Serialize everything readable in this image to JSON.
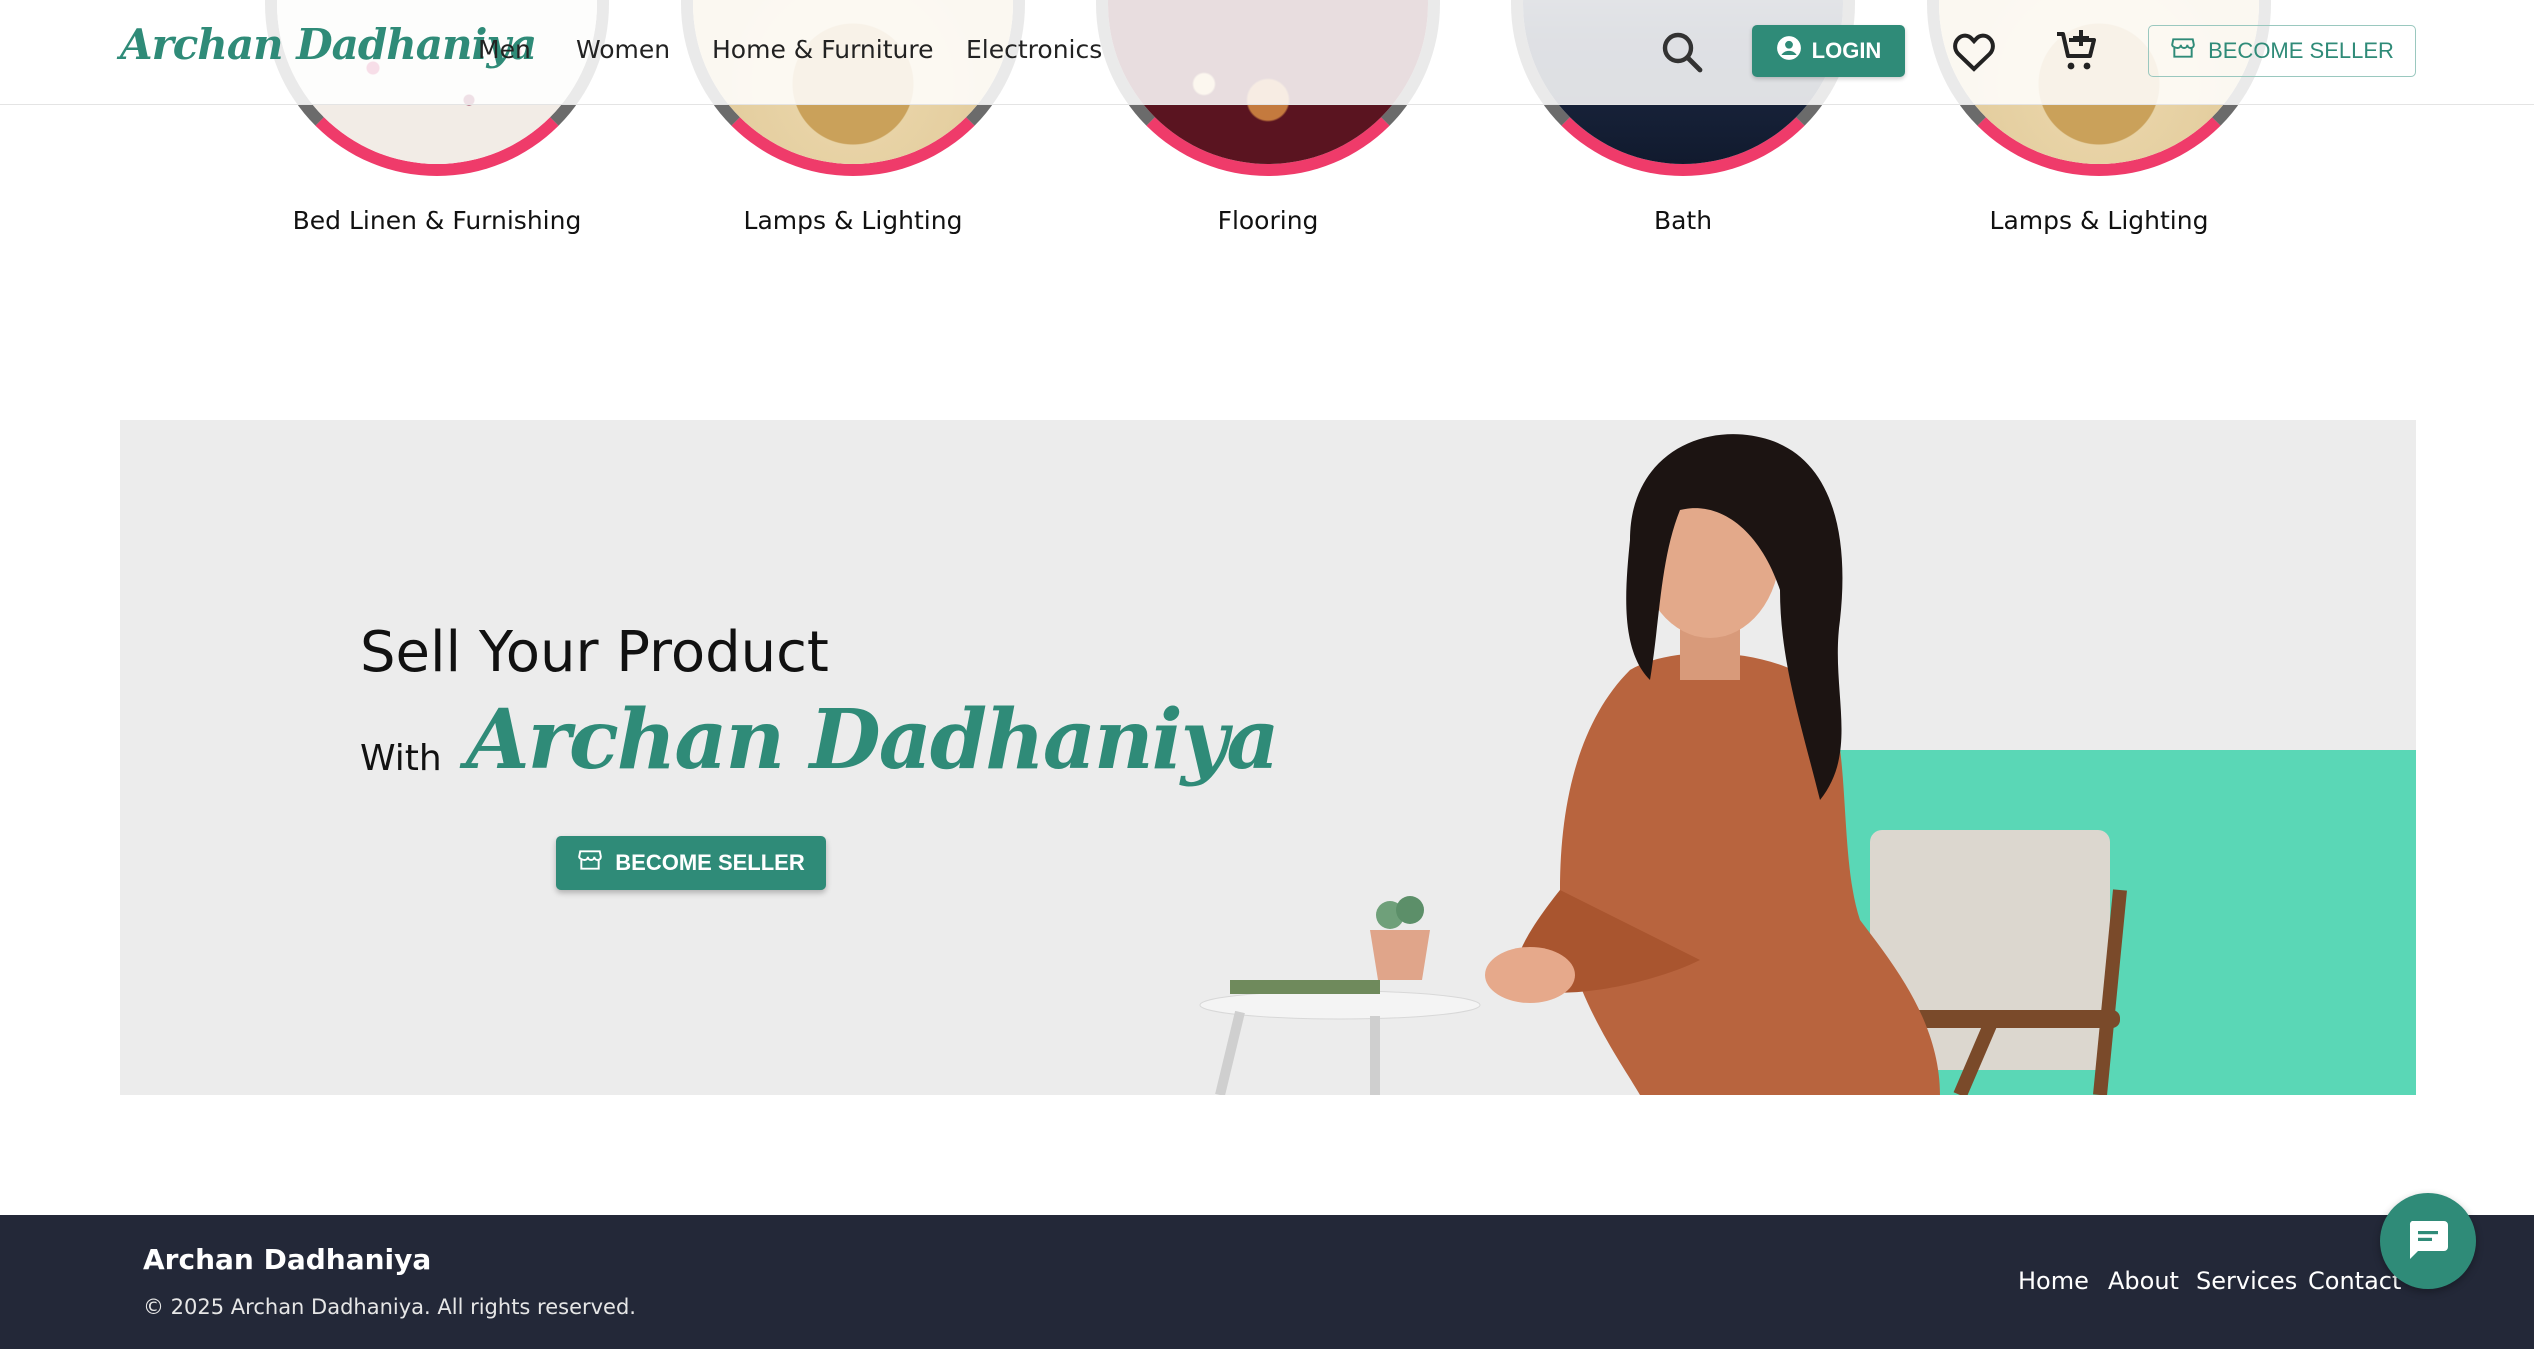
{
  "brand": {
    "name": "Archan Dadhaniya",
    "color": "#2f8b78"
  },
  "nav": {
    "items": [
      {
        "label": "Men"
      },
      {
        "label": "Women"
      },
      {
        "label": "Home & Furniture"
      },
      {
        "label": "Electronics"
      }
    ]
  },
  "header": {
    "login_label": "LOGIN",
    "become_seller_label": "BECOME SELLER",
    "icons": [
      "search-icon",
      "account-circle-icon",
      "heart-icon",
      "cart-add-icon",
      "store-icon"
    ]
  },
  "categories": [
    {
      "label": "Bed Linen & Furnishing"
    },
    {
      "label": "Lamps & Lighting"
    },
    {
      "label": "Flooring"
    },
    {
      "label": "Bath"
    },
    {
      "label": "Lamps & Lighting"
    }
  ],
  "banner": {
    "title": "Sell Your Product",
    "with": "With",
    "brand": "Archan Dadhaniya",
    "button": "BECOME SELLER",
    "accent": "#5ad7b6"
  },
  "footer": {
    "brand": "Archan Dadhaniya",
    "copyright": "© 2025 Archan Dadhaniya. All rights reserved.",
    "links": [
      {
        "label": "Home"
      },
      {
        "label": "About"
      },
      {
        "label": "Services"
      },
      {
        "label": "Contact"
      }
    ]
  },
  "chat": {
    "icon": "chat-icon"
  }
}
